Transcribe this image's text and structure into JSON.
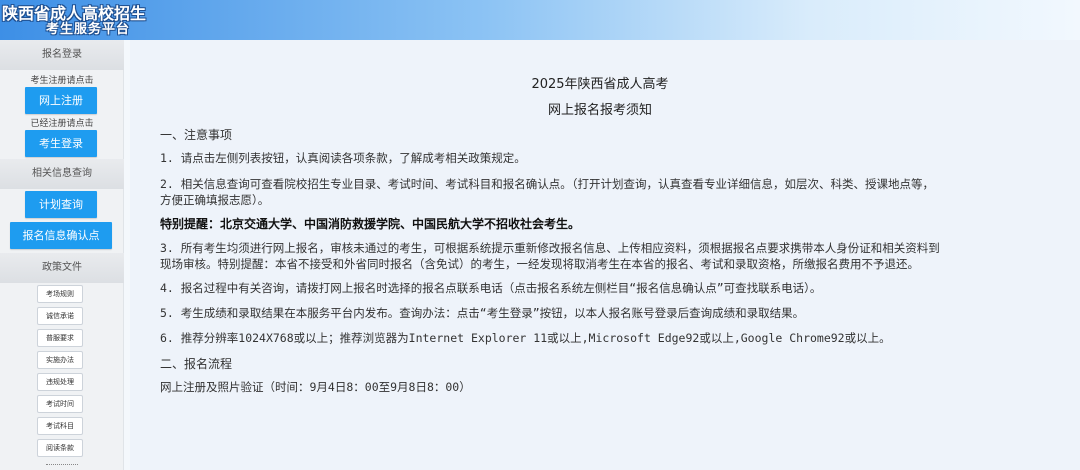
{
  "header": {
    "title_line1": "陕西省成人高校招生",
    "title_line2": "考生服务平台"
  },
  "sidebar": {
    "register_section": "报名登录",
    "register_hint": "考生注册请点击",
    "register_button": "网上注册",
    "login_hint": "已经注册请点击",
    "login_button": "考生登录",
    "info_section": "相关信息查询",
    "plan_button": "计划查询",
    "confirm_button": "报名信息确认点",
    "policy_section": "政策文件",
    "policy_items": [
      "考场规则",
      "诚信承诺",
      "普服要求",
      "实施办法",
      "违规处理",
      "考试时间",
      "考试科目",
      "阅读条款"
    ]
  },
  "main": {
    "title1": "2025年陕西省成人高考",
    "title2": "网上报名报考须知",
    "section1": "一、注意事项",
    "item1": "1. 请点击左侧列表按钮，认真阅读各项条款，了解成考相关政策规定。",
    "item2_line1": "2. 相关信息查询可查看院校招生专业目录、考试时间、考试科目和报名确认点。（打开计划查询，认真查看专业详细信息，如层次、科类、授课地点等，",
    "item2_line2": "方便正确填报志愿）。",
    "special_note": "特别提醒：北京交通大学、中国消防救援学院、中国民航大学不招收社会考生。",
    "item3_line1": "3. 所有考生均须进行网上报名，审核未通过的考生，可根据系统提示重新修改报名信息、上传相应资料，须根据报名点要求携带本人身份证和相关资料到",
    "item3_line2": "现场审核。特别提醒：本省不接受和外省同时报名（含免试）的考生，一经发现将取消考生在本省的报名、考试和录取资格，所缴报名费用不予退还。",
    "item4": "4. 报名过程中有关咨询，请拨打网上报名时选择的报名点联系电话（点击报名系统左侧栏目“报名信息确认点”可查找联系电话）。",
    "item5": "5. 考生成绩和录取结果在本服务平台内发布。查询办法：点击“考生登录”按钮，以本人报名账号登录后查询成绩和录取结果。",
    "item6": "6. 推荐分辨率1024X768或以上；推荐浏览器为Internet Explorer 11或以上,Microsoft Edge92或以上,Google Chrome92或以上。",
    "section2": "二、报名流程",
    "step1": "网上注册及照片验证（时间：9月4日8：00至9月8日8：00）"
  }
}
